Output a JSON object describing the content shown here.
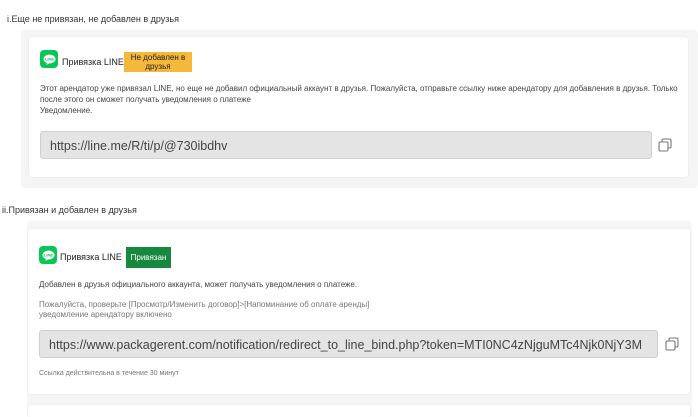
{
  "section1": {
    "title": "i.Еще не привязан, не добавлен в друзья",
    "label": "Привязка LINE",
    "badge": "Не добавлен в друзья",
    "description": "Этот арендатор уже привязал LINE, но еще не добавил официальный аккаунт в друзья. Пожалуйста, отправьте ссылку ниже арендатору для добавления в друзья. Только после этого он сможет получать уведомления о платеже",
    "notice_label": "Уведомление.",
    "url": "https://line.me/R/ti/p/@730ibdhv"
  },
  "section2": {
    "title": "ii.Привязан и добавлен в друзья",
    "label": "Привязка LINE",
    "badge": "Привязан",
    "description": "Добавлен в друзья официального аккаунта, может получать уведомления о платеже.",
    "hint_line1": "Пожалуйста, проверьте [Просмотр/Изменить договор]>[Напоминание об оплате аренды]",
    "hint_line2": "уведомление арендатору включено",
    "url": "https://www.packagerent.com/notification/redirect_to_line_bind.php?token=MTI0NC4zNjguMTc4Njk0NjY3M",
    "validity": "Ссылка действительна в течение 30 минут"
  },
  "colors": {
    "line_green": "#06c755",
    "badge_yellow": "#f4b83a",
    "badge_green": "#17893f"
  },
  "icons": {
    "line": "line-logo-icon",
    "copy": "copy-icon"
  }
}
